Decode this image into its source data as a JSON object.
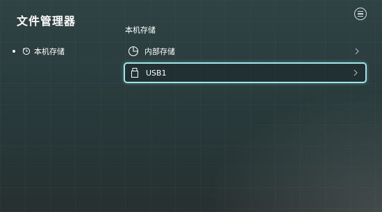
{
  "app": {
    "title": "文件管理器"
  },
  "sidebar": {
    "items": [
      {
        "label": "本机存储",
        "icon": "clock-storage-icon",
        "selected": true
      }
    ]
  },
  "main": {
    "section_title": "本机存储",
    "items": [
      {
        "label": "内部存储",
        "icon": "pie-chart-icon"
      },
      {
        "label": "USB1",
        "icon": "usb-drive-icon",
        "focused": true
      }
    ]
  },
  "header": {
    "menu_icon": "menu-icon"
  },
  "colors": {
    "focus_border": "#9fe7ef",
    "text": "#ffffff",
    "background": "#2c3e40"
  }
}
